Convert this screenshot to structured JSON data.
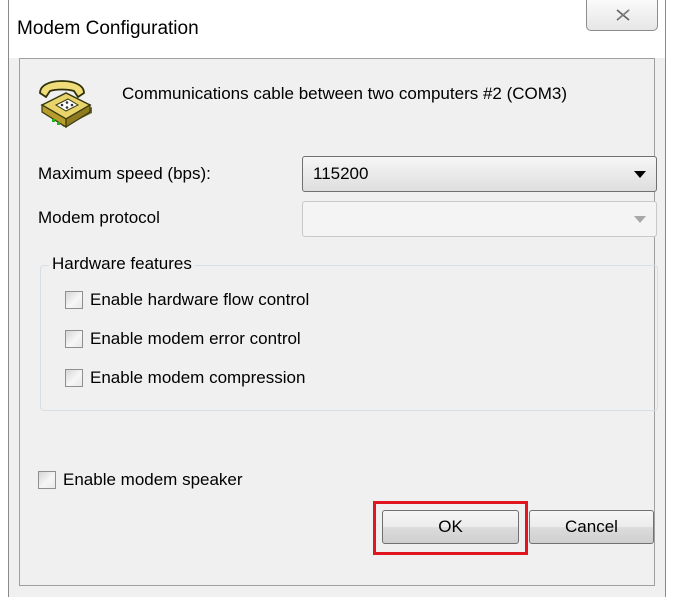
{
  "window": {
    "title": "Modem Configuration"
  },
  "modem": {
    "name": "Communications cable between two computers #2 (COM3)"
  },
  "fields": {
    "max_speed_label": "Maximum speed (bps):",
    "max_speed_value": "115200",
    "protocol_label": "Modem protocol",
    "protocol_value": ""
  },
  "hardware": {
    "title": "Hardware features",
    "options": [
      {
        "label": "Enable hardware flow control",
        "checked": false
      },
      {
        "label": "Enable modem error control",
        "checked": false
      },
      {
        "label": "Enable modem compression",
        "checked": false
      }
    ]
  },
  "speaker": {
    "label": "Enable modem speaker",
    "checked": false
  },
  "buttons": {
    "ok": "OK",
    "cancel": "Cancel"
  },
  "icons": {
    "close": "close-icon",
    "phone": "telephone-icon"
  },
  "colors": {
    "highlight": "#e0161f",
    "dialog_bg": "#f0f0f0"
  }
}
